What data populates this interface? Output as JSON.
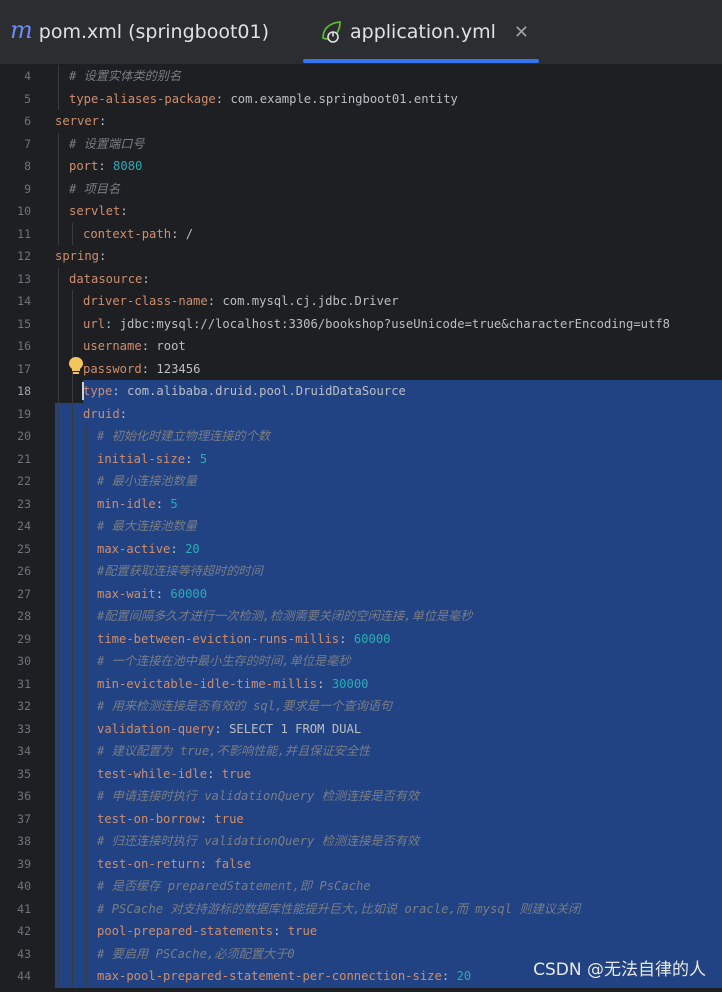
{
  "tabs": [
    {
      "label": "pom.xml (springboot01)",
      "icon": "maven-m-icon",
      "active": false
    },
    {
      "label": "application.yml",
      "icon": "spring-leaf-icon",
      "active": true
    }
  ],
  "colors": {
    "key": "#cf8e6d",
    "value": "#bcbec4",
    "number": "#2aacb8",
    "comment": "#7a7e85",
    "selection": "#214283",
    "accent": "#3574f0"
  },
  "lines": [
    {
      "n": "4",
      "indent": 1,
      "type": "comment",
      "text": "# 设置实体类的别名"
    },
    {
      "n": "5",
      "indent": 1,
      "type": "kv",
      "key": "type-aliases-package",
      "value": "com.example.springboot01.entity"
    },
    {
      "n": "6",
      "indent": 0,
      "type": "key",
      "key": "server"
    },
    {
      "n": "7",
      "indent": 1,
      "type": "comment",
      "text": "# 设置端口号"
    },
    {
      "n": "8",
      "indent": 1,
      "type": "kv",
      "key": "port",
      "value": "8080",
      "num": true
    },
    {
      "n": "9",
      "indent": 1,
      "type": "comment",
      "text": "# 项目名"
    },
    {
      "n": "10",
      "indent": 1,
      "type": "key",
      "key": "servlet"
    },
    {
      "n": "11",
      "indent": 2,
      "type": "kv",
      "key": "context-path",
      "value": "/"
    },
    {
      "n": "12",
      "indent": 0,
      "type": "key",
      "key": "spring"
    },
    {
      "n": "13",
      "indent": 1,
      "type": "key",
      "key": "datasource"
    },
    {
      "n": "14",
      "indent": 2,
      "type": "kv",
      "key": "driver-class-name",
      "value": "com.mysql.cj.jdbc.Driver"
    },
    {
      "n": "15",
      "indent": 2,
      "type": "kv",
      "key": "url",
      "value": "jdbc:mysql://localhost:3306/bookshop?useUnicode=true&characterEncoding=utf8"
    },
    {
      "n": "16",
      "indent": 2,
      "type": "kv",
      "key": "username",
      "value": "root"
    },
    {
      "n": "17",
      "indent": 2,
      "type": "kv",
      "key": "password",
      "value": "123456"
    },
    {
      "n": "18",
      "indent": 2,
      "type": "kv",
      "key": "type",
      "value": "com.alibaba.druid.pool.DruidDataSource",
      "sel": "partial",
      "current": true
    },
    {
      "n": "19",
      "indent": 2,
      "type": "key",
      "key": "druid",
      "sel": "full"
    },
    {
      "n": "20",
      "indent": 3,
      "type": "comment",
      "text": "# 初始化时建立物理连接的个数",
      "sel": "full"
    },
    {
      "n": "21",
      "indent": 3,
      "type": "kv",
      "key": "initial-size",
      "value": "5",
      "num": true,
      "sel": "full"
    },
    {
      "n": "22",
      "indent": 3,
      "type": "comment",
      "text": "# 最小连接池数量",
      "sel": "full"
    },
    {
      "n": "23",
      "indent": 3,
      "type": "kv",
      "key": "min-idle",
      "value": "5",
      "num": true,
      "sel": "full"
    },
    {
      "n": "24",
      "indent": 3,
      "type": "comment",
      "text": "# 最大连接池数量",
      "sel": "full"
    },
    {
      "n": "25",
      "indent": 3,
      "type": "kv",
      "key": "max-active",
      "value": "20",
      "num": true,
      "sel": "full"
    },
    {
      "n": "26",
      "indent": 3,
      "type": "comment",
      "text": "#配置获取连接等待超时的时间",
      "sel": "full"
    },
    {
      "n": "27",
      "indent": 3,
      "type": "kv",
      "key": "max-wait",
      "value": "60000",
      "num": true,
      "sel": "full"
    },
    {
      "n": "28",
      "indent": 3,
      "type": "comment",
      "text": "#配置间隔多久才进行一次检测,检测需要关闭的空闲连接,单位是毫秒",
      "sel": "full"
    },
    {
      "n": "29",
      "indent": 3,
      "type": "kv",
      "key": "time-between-eviction-runs-millis",
      "value": "60000",
      "num": true,
      "sel": "full"
    },
    {
      "n": "30",
      "indent": 3,
      "type": "comment",
      "text": "# 一个连接在池中最小生存的时间,单位是毫秒",
      "sel": "full"
    },
    {
      "n": "31",
      "indent": 3,
      "type": "kv",
      "key": "min-evictable-idle-time-millis",
      "value": "30000",
      "num": true,
      "sel": "full"
    },
    {
      "n": "32",
      "indent": 3,
      "type": "comment",
      "text": "# 用来检测连接是否有效的 sql,要求是一个查询语句",
      "sel": "full"
    },
    {
      "n": "33",
      "indent": 3,
      "type": "kv",
      "key": "validation-query",
      "value": "SELECT 1 FROM DUAL",
      "sel": "full"
    },
    {
      "n": "34",
      "indent": 3,
      "type": "comment",
      "text": "# 建议配置为 true,不影响性能,并且保证安全性",
      "sel": "full"
    },
    {
      "n": "35",
      "indent": 3,
      "type": "kv",
      "key": "test-while-idle",
      "value": "true",
      "kw": true,
      "sel": "full"
    },
    {
      "n": "36",
      "indent": 3,
      "type": "comment",
      "text": "# 申请连接时执行 validationQuery 检测连接是否有效",
      "sel": "full"
    },
    {
      "n": "37",
      "indent": 3,
      "type": "kv",
      "key": "test-on-borrow",
      "value": "true",
      "kw": true,
      "sel": "full"
    },
    {
      "n": "38",
      "indent": 3,
      "type": "comment",
      "text": "# 归还连接时执行 validationQuery 检测连接是否有效",
      "sel": "full"
    },
    {
      "n": "39",
      "indent": 3,
      "type": "kv",
      "key": "test-on-return",
      "value": "false",
      "kw": true,
      "sel": "full"
    },
    {
      "n": "40",
      "indent": 3,
      "type": "comment",
      "text": "# 是否缓存 preparedStatement,即 PsCache",
      "sel": "full"
    },
    {
      "n": "41",
      "indent": 3,
      "type": "comment",
      "text": "# PSCache 对支持游标的数据库性能提升巨大,比如说 oracle,而 mysql 则建议关闭",
      "sel": "full"
    },
    {
      "n": "42",
      "indent": 3,
      "type": "kv",
      "key": "pool-prepared-statements",
      "value": "true",
      "kw": true,
      "sel": "full"
    },
    {
      "n": "43",
      "indent": 3,
      "type": "comment",
      "text": "# 要启用 PSCache,必须配置大于0",
      "sel": "full"
    },
    {
      "n": "44",
      "indent": 3,
      "type": "kv",
      "key": "max-pool-prepared-statement-per-connection-size",
      "value": "20",
      "num": true,
      "sel": "full"
    }
  ],
  "watermark": "CSDN @无法自律的人"
}
